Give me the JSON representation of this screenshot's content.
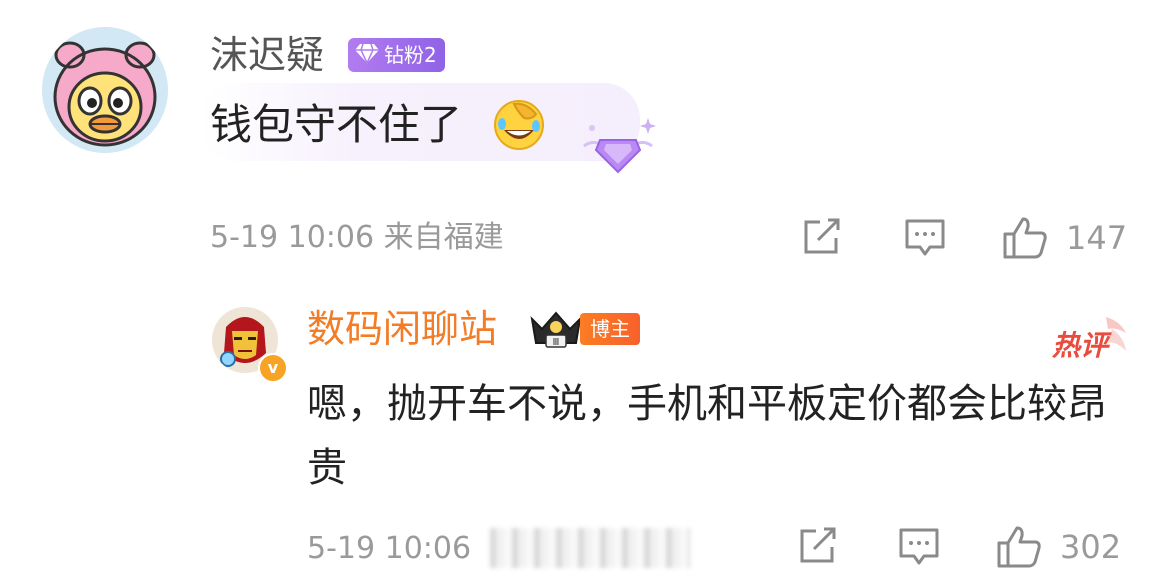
{
  "comment": {
    "username": "沫迟疑",
    "fan_badge": "钻粉2",
    "text": "钱包守不住了",
    "emoji": "facepalm-laugh-emoji",
    "meta": "5-19 10:06  来自福建",
    "likes": "147",
    "icons": [
      "share-icon",
      "comment-icon",
      "thumbs-up-icon"
    ]
  },
  "reply": {
    "username": "数码闲聊站",
    "crown_level": "Ⅲ",
    "blogger_badge": "博主",
    "hot_tag": "热评",
    "text": "嗯，抛开车不说，手机和平板定价都会比较昂贵",
    "meta": "5-19 10:06",
    "likes": "302",
    "verified": "v"
  },
  "colors": {
    "username_reply": "#f37c27",
    "fan_badge": "#9d6ceb",
    "meta_gray": "#9a9a9a",
    "hot_tag": "#e94b3c"
  }
}
